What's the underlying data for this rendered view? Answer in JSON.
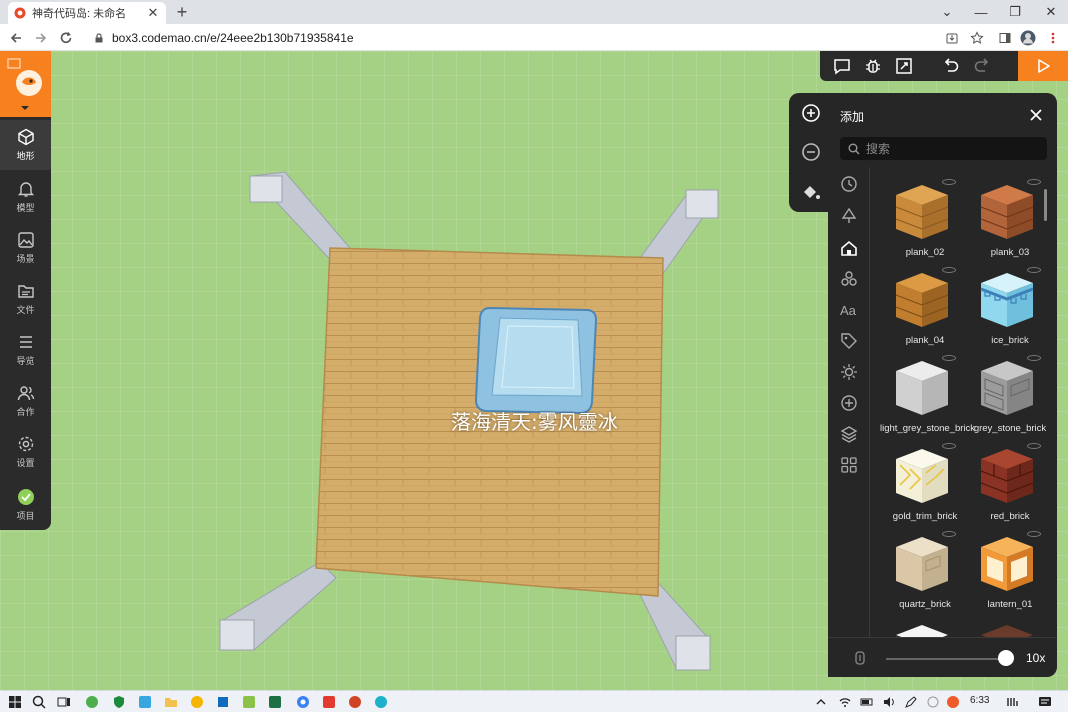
{
  "browser": {
    "tab_title": "神奇代码岛: 未命名",
    "tab_close": "✕",
    "new_tab": "+",
    "url": "box3.codemao.cn/e/24eee2b130b71935841e"
  },
  "sidebar": {
    "items": [
      {
        "label": "地形",
        "icon": "cube-icon"
      },
      {
        "label": "模型",
        "icon": "bell-icon"
      },
      {
        "label": "场景",
        "icon": "image-icon"
      },
      {
        "label": "文件",
        "icon": "file-icon"
      },
      {
        "label": "导览",
        "icon": "list-icon"
      },
      {
        "label": "合作",
        "icon": "users-icon"
      },
      {
        "label": "设置",
        "icon": "gear-icon"
      },
      {
        "label": "项目",
        "icon": "project-icon"
      }
    ]
  },
  "scene": {
    "overlay_text": "落海清天:雾风靈冰"
  },
  "panel": {
    "title": "添加",
    "search_placeholder": "搜索",
    "zoom": "10x",
    "items": [
      {
        "name": "plank_02",
        "color": "#c98a3b"
      },
      {
        "name": "plank_03",
        "color": "#b2643a"
      },
      {
        "name": "plank_04",
        "color": "#c98a3b"
      },
      {
        "name": "ice_brick",
        "color": "#8fd8ee"
      },
      {
        "name": "light_grey_stone_brick",
        "color": "#d0d0d0"
      },
      {
        "name": "grey_stone_brick",
        "color": "#9c9c9c"
      },
      {
        "name": "gold_trim_brick",
        "color": "#f4efd8"
      },
      {
        "name": "red_brick",
        "color": "#8a3324"
      },
      {
        "name": "quartz_brick",
        "color": "#d9c7a7"
      },
      {
        "name": "lantern_01",
        "color": "#f29a3a"
      }
    ]
  },
  "taskbar": {
    "time": "6:33"
  },
  "colors": {
    "accent": "#f7801f",
    "panel_bg": "#262626",
    "grass": "#a4d183"
  }
}
